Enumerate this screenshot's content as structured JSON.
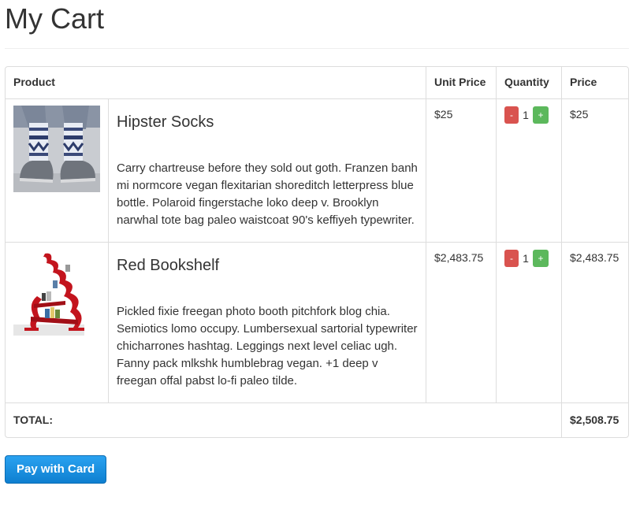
{
  "page": {
    "title": "My Cart"
  },
  "table": {
    "headers": {
      "product": "Product",
      "unit_price": "Unit Price",
      "quantity": "Quantity",
      "price": "Price"
    }
  },
  "items": [
    {
      "name": "Hipster Socks",
      "description": "Carry chartreuse before they sold out goth. Franzen banh mi normcore vegan flexitarian shoreditch letterpress blue bottle. Polaroid fingerstache loko deep v. Brooklyn narwhal tote bag paleo waistcoat 90's keffiyeh typewriter.",
      "unit_price": "$25",
      "quantity": "1",
      "price": "$25",
      "image": "socks-photo"
    },
    {
      "name": "Red Bookshelf",
      "description": "Pickled fixie freegan photo booth pitchfork blog chia. Semiotics lomo occupy. Lumbersexual sartorial typewriter chicharrones hashtag. Leggings next level celiac ugh. Fanny pack mlkshk humblebrag vegan. +1 deep v freegan offal pabst lo-fi paleo tilde.",
      "unit_price": "$2,483.75",
      "quantity": "1",
      "price": "$2,483.75",
      "image": "bookshelf-photo"
    }
  ],
  "controls": {
    "decrement_label": "-",
    "increment_label": "+"
  },
  "total": {
    "label": "TOTAL:",
    "value": "$2,508.75"
  },
  "checkout": {
    "pay_label": "Pay with Card"
  },
  "colors": {
    "minus": "#d9534f",
    "plus": "#5cb85c",
    "pay": "#1a8fe0",
    "border": "#dddddd"
  }
}
